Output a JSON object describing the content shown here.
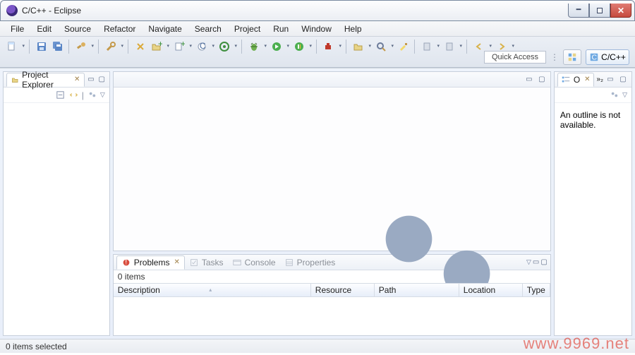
{
  "titlebar": {
    "title": "C/C++ - Eclipse"
  },
  "menu": {
    "items": [
      "File",
      "Edit",
      "Source",
      "Refactor",
      "Navigate",
      "Search",
      "Project",
      "Run",
      "Window",
      "Help"
    ]
  },
  "toolbar_right": {
    "quick_access": "Quick Access",
    "perspective_label": "C/C++"
  },
  "project_explorer": {
    "title": "Project Explorer"
  },
  "outline": {
    "title": "O",
    "message": "An outline is not available."
  },
  "problems": {
    "tabs": {
      "problems": "Problems",
      "tasks": "Tasks",
      "console": "Console",
      "properties": "Properties"
    },
    "items_label": "0 items",
    "columns": {
      "description": "Description",
      "resource": "Resource",
      "path": "Path",
      "location": "Location",
      "type": "Type"
    }
  },
  "statusbar": {
    "text": "0 items selected"
  },
  "watermark": "www.9969.net"
}
